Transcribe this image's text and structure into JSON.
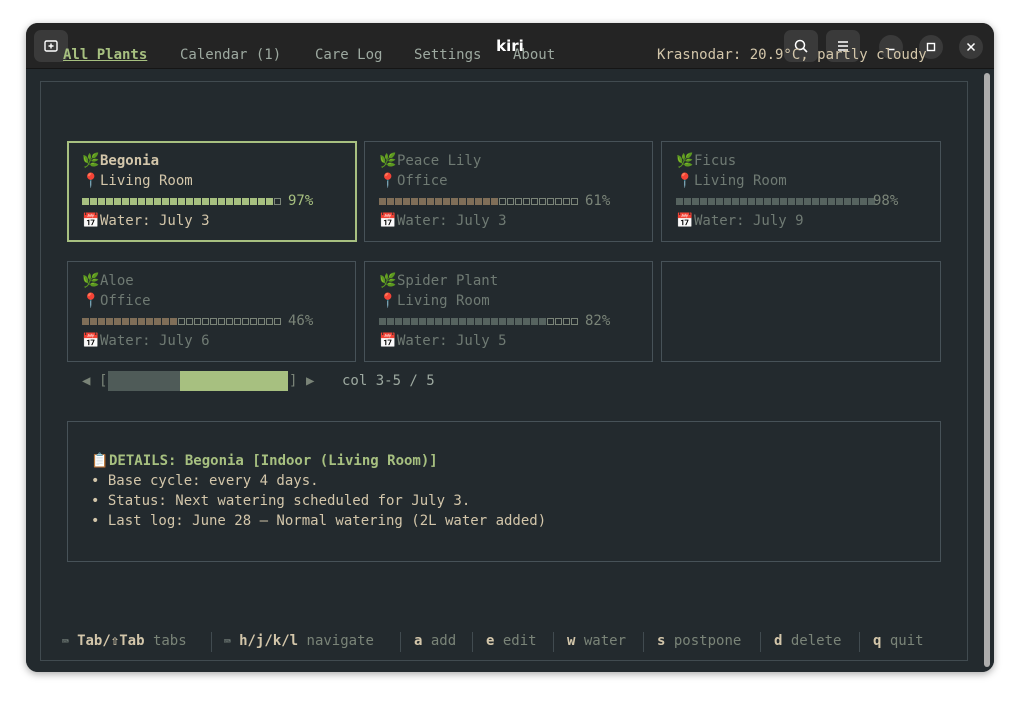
{
  "window": {
    "title": "kiri"
  },
  "titlebar_icons": {
    "new_tab": "new-tab-icon",
    "search": "search-icon",
    "menu": "hamburger-menu-icon",
    "minimize": "minimize-icon",
    "maximize": "maximize-icon",
    "close": "close-icon"
  },
  "tabs": [
    {
      "label": "All Plants",
      "active": true
    },
    {
      "label": "Calendar (1)",
      "active": false
    },
    {
      "label": "Care Log",
      "active": false
    },
    {
      "label": "Settings",
      "active": false
    },
    {
      "label": "About",
      "active": false
    }
  ],
  "weather": "Krasnodar: 20.9°C, partly cloudy",
  "plants": [
    {
      "name": "Begonia",
      "location": "Living Room",
      "percent": 97,
      "percent_label": "97%",
      "water": "Water: July 3",
      "selected": true
    },
    {
      "name": "Peace Lily",
      "location": "Office",
      "percent": 61,
      "percent_label": "61%",
      "water": "Water: July 3",
      "selected": false
    },
    {
      "name": "Ficus",
      "location": "Living Room",
      "percent": 98,
      "percent_label": "98%",
      "water": "Water: July 9",
      "selected": false
    },
    {
      "name": "Aloe",
      "location": "Office",
      "percent": 46,
      "percent_label": "46%",
      "water": "Water: July 6",
      "selected": false
    },
    {
      "name": "Spider Plant",
      "location": "Living Room",
      "percent": 82,
      "percent_label": "82%",
      "water": "Water: July 5",
      "selected": false
    }
  ],
  "icons": {
    "plant": "🌿",
    "location": "📍",
    "calendar": "📅",
    "clipboard": "📋"
  },
  "pager": {
    "left_arrow": "◀",
    "open_bracket": "[",
    "close_bracket": "]",
    "right_arrow": "▶",
    "label": "col 3-5 / 5",
    "position_fraction": 0.4,
    "visible_fraction": 0.6
  },
  "details": {
    "title": "DETAILS: Begonia [Indoor (Living Room)]",
    "lines": [
      "• Base cycle: every 4 days.",
      "• Status: Next watering scheduled for July 3.",
      "• Last log: June 28 — Normal watering (2L water added)"
    ]
  },
  "footer": [
    {
      "key": "Tab/⇧Tab",
      "desc": "tabs",
      "icon": "⌨"
    },
    {
      "key": "h/j/k/l",
      "desc": "navigate",
      "icon": "⌨"
    },
    {
      "key": "a",
      "desc": "add"
    },
    {
      "key": "e",
      "desc": "edit"
    },
    {
      "key": "w",
      "desc": "water"
    },
    {
      "key": "s",
      "desc": "postpone"
    },
    {
      "key": "d",
      "desc": "delete"
    },
    {
      "key": "q",
      "desc": "quit"
    }
  ],
  "colors": {
    "accent": "#a7c080",
    "background": "#232a2e",
    "warning_bar": "#7f6e58",
    "text": "#d3c6aa"
  }
}
